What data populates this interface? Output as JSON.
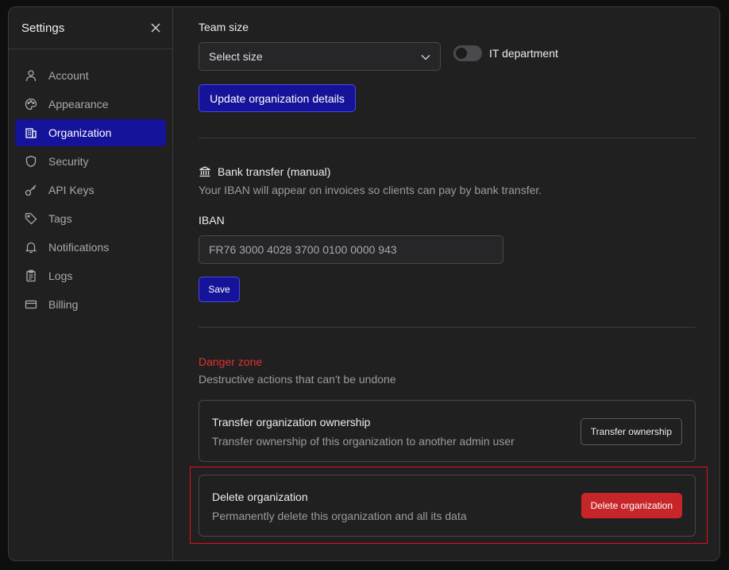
{
  "sidebar": {
    "title": "Settings",
    "items": [
      {
        "label": "Account",
        "icon": "user-icon"
      },
      {
        "label": "Appearance",
        "icon": "palette-icon"
      },
      {
        "label": "Organization",
        "icon": "building-icon",
        "active": true
      },
      {
        "label": "Security",
        "icon": "shield-icon"
      },
      {
        "label": "API Keys",
        "icon": "key-icon"
      },
      {
        "label": "Tags",
        "icon": "tag-icon"
      },
      {
        "label": "Notifications",
        "icon": "bell-icon"
      },
      {
        "label": "Logs",
        "icon": "clipboard-icon"
      },
      {
        "label": "Billing",
        "icon": "credit-card-icon"
      }
    ]
  },
  "org": {
    "team_size_label": "Team size",
    "team_size_value": "Select size",
    "it_department_label": "IT department",
    "it_department_on": false,
    "update_button": "Update organization details"
  },
  "bank": {
    "title": "Bank transfer (manual)",
    "description": "Your IBAN will appear on invoices so clients can pay by bank transfer.",
    "iban_label": "IBAN",
    "iban_value": "FR76 3000 4028 3700 0100 0000 943",
    "save_button": "Save"
  },
  "danger": {
    "title": "Danger zone",
    "description": "Destructive actions that can't be undone",
    "transfer": {
      "title": "Transfer organization ownership",
      "description": "Transfer ownership of this organization to another admin user",
      "button": "Transfer ownership"
    },
    "delete": {
      "title": "Delete organization",
      "description": "Permanently delete this organization and all its data",
      "button": "Delete organization"
    }
  },
  "colors": {
    "accent": "#14139a",
    "danger": "#c6262a",
    "danger_text": "#e0302f",
    "highlight_box": "#e01414"
  }
}
